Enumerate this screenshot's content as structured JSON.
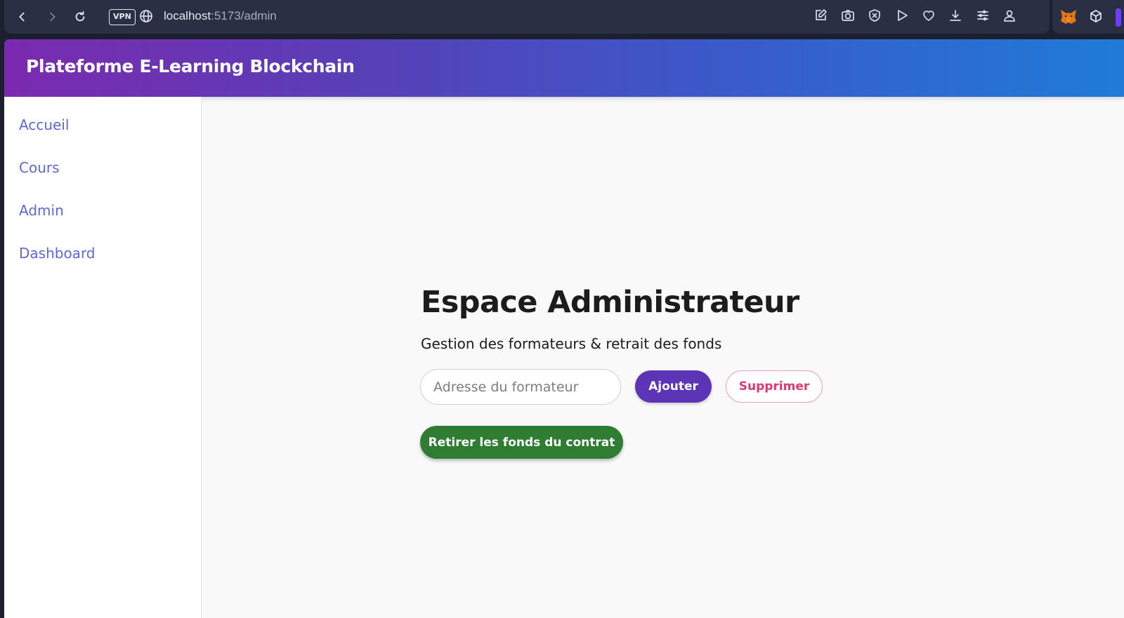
{
  "browser": {
    "vpn_label": "VPN",
    "url_host": "localhost",
    "url_path": ":5173/admin"
  },
  "app": {
    "title": "Plateforme E-Learning Blockchain",
    "header_gradient": [
      "#7b2ab0",
      "#1f7bd8"
    ]
  },
  "sidebar": {
    "items": [
      {
        "label": "Accueil"
      },
      {
        "label": "Cours"
      },
      {
        "label": "Admin"
      },
      {
        "label": "Dashboard"
      }
    ],
    "link_color": "#5d67d6"
  },
  "main": {
    "title": "Espace Administrateur",
    "subtitle": "Gestion des formateurs & retrait des fonds",
    "trainer_input": {
      "placeholder": "Adresse du formateur",
      "value": ""
    },
    "add_button": "Ajouter",
    "remove_button": "Supprimer",
    "withdraw_button": "Retirer les fonds du contrat",
    "colors": {
      "add": "#5b35b6",
      "remove": "#e0386e",
      "withdraw": "#2e7d32"
    }
  }
}
